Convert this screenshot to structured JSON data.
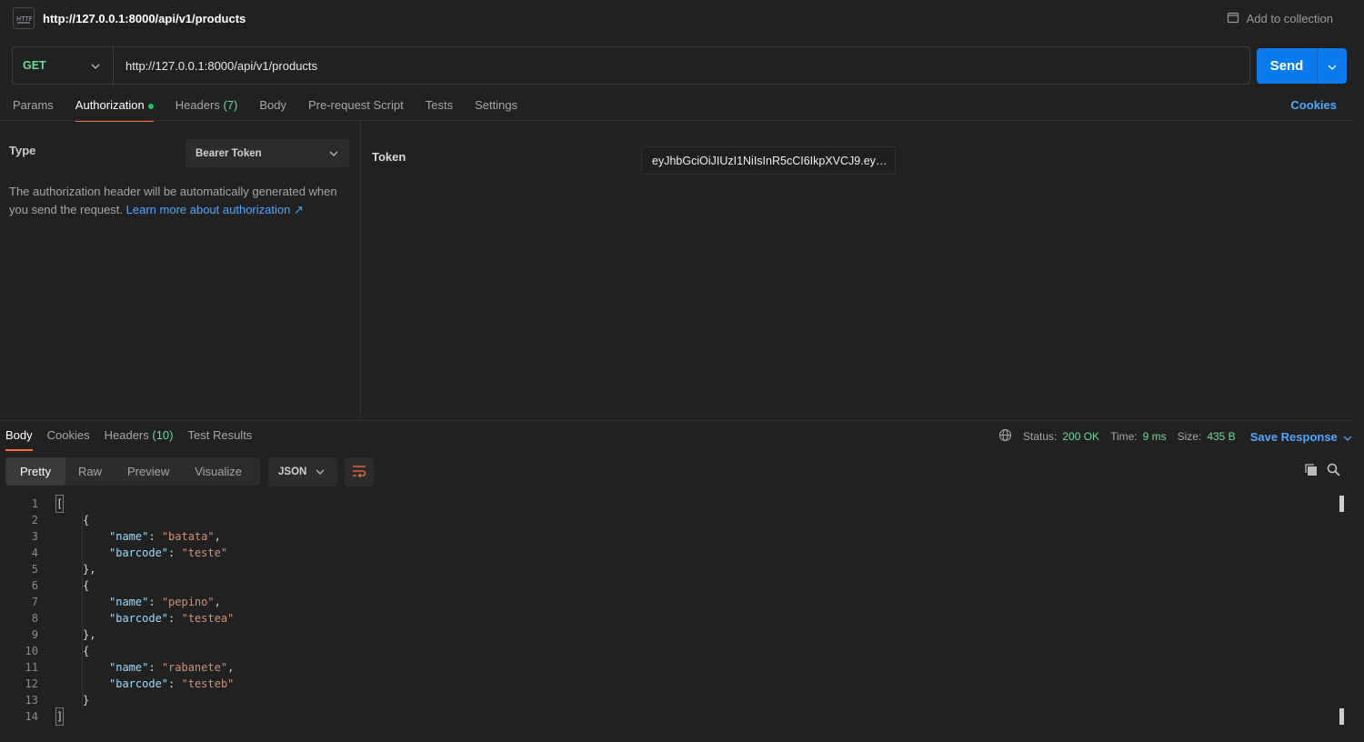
{
  "header": {
    "icon": "http-icon",
    "icon_text": "HTTP",
    "title_url": "http://127.0.0.1:8000/api/v1/products",
    "add_to_collection": "Add to collection"
  },
  "request": {
    "method": "GET",
    "url": "http://127.0.0.1:8000/api/v1/products",
    "send_label": "Send"
  },
  "request_tabs": [
    {
      "label": "Params"
    },
    {
      "label": "Authorization",
      "active": true,
      "dot": true
    },
    {
      "label": "Headers",
      "count": "(7)"
    },
    {
      "label": "Body"
    },
    {
      "label": "Pre-request Script"
    },
    {
      "label": "Tests"
    },
    {
      "label": "Settings"
    }
  ],
  "cookies_label": "Cookies",
  "auth": {
    "type_label": "Type",
    "type_value": "Bearer Token",
    "description": "The authorization header will be automatically generated when you send the request.",
    "learn_more": "Learn more about authorization ↗",
    "token_label": "Token",
    "token_value": "eyJhbGciOiJIUzI1NiIsInR5cCI6IkpXVCJ9.ey…"
  },
  "response_tabs": [
    {
      "label": "Body",
      "active": true
    },
    {
      "label": "Cookies"
    },
    {
      "label": "Headers",
      "count": "(10)"
    },
    {
      "label": "Test Results"
    }
  ],
  "response_status": {
    "status_label": "Status:",
    "status_value": "200 OK",
    "time_label": "Time:",
    "time_value": "9 ms",
    "size_label": "Size:",
    "size_value": "435 B",
    "save_response": "Save Response"
  },
  "view_modes": [
    "Pretty",
    "Raw",
    "Preview",
    "Visualize"
  ],
  "format": "JSON",
  "colors": {
    "accent": "#ff6c37",
    "send": "#097bed",
    "method": "#6bdd9a",
    "link": "#4ea8ff"
  },
  "response_body": [
    {
      "n": "1",
      "indent": 0,
      "tokens": [
        [
          "b",
          "["
        ]
      ]
    },
    {
      "n": "2",
      "indent": 1,
      "tokens": [
        [
          "p",
          "{"
        ]
      ]
    },
    {
      "n": "3",
      "indent": 2,
      "tokens": [
        [
          "k",
          "\"name\""
        ],
        [
          "p",
          ": "
        ],
        [
          "s",
          "\"batata\""
        ],
        [
          "p",
          ","
        ]
      ]
    },
    {
      "n": "4",
      "indent": 2,
      "tokens": [
        [
          "k",
          "\"barcode\""
        ],
        [
          "p",
          ": "
        ],
        [
          "s",
          "\"teste\""
        ]
      ]
    },
    {
      "n": "5",
      "indent": 1,
      "tokens": [
        [
          "p",
          "},"
        ]
      ]
    },
    {
      "n": "6",
      "indent": 1,
      "tokens": [
        [
          "p",
          "{"
        ]
      ]
    },
    {
      "n": "7",
      "indent": 2,
      "tokens": [
        [
          "k",
          "\"name\""
        ],
        [
          "p",
          ": "
        ],
        [
          "s",
          "\"pepino\""
        ],
        [
          "p",
          ","
        ]
      ]
    },
    {
      "n": "8",
      "indent": 2,
      "tokens": [
        [
          "k",
          "\"barcode\""
        ],
        [
          "p",
          ": "
        ],
        [
          "s",
          "\"testea\""
        ]
      ]
    },
    {
      "n": "9",
      "indent": 1,
      "tokens": [
        [
          "p",
          "},"
        ]
      ]
    },
    {
      "n": "10",
      "indent": 1,
      "tokens": [
        [
          "p",
          "{"
        ]
      ]
    },
    {
      "n": "11",
      "indent": 2,
      "tokens": [
        [
          "k",
          "\"name\""
        ],
        [
          "p",
          ": "
        ],
        [
          "s",
          "\"rabanete\""
        ],
        [
          "p",
          ","
        ]
      ]
    },
    {
      "n": "12",
      "indent": 2,
      "tokens": [
        [
          "k",
          "\"barcode\""
        ],
        [
          "p",
          ": "
        ],
        [
          "s",
          "\"testeb\""
        ]
      ]
    },
    {
      "n": "13",
      "indent": 1,
      "tokens": [
        [
          "p",
          "}"
        ]
      ]
    },
    {
      "n": "14",
      "indent": 0,
      "tokens": [
        [
          "b",
          "]"
        ]
      ]
    }
  ]
}
